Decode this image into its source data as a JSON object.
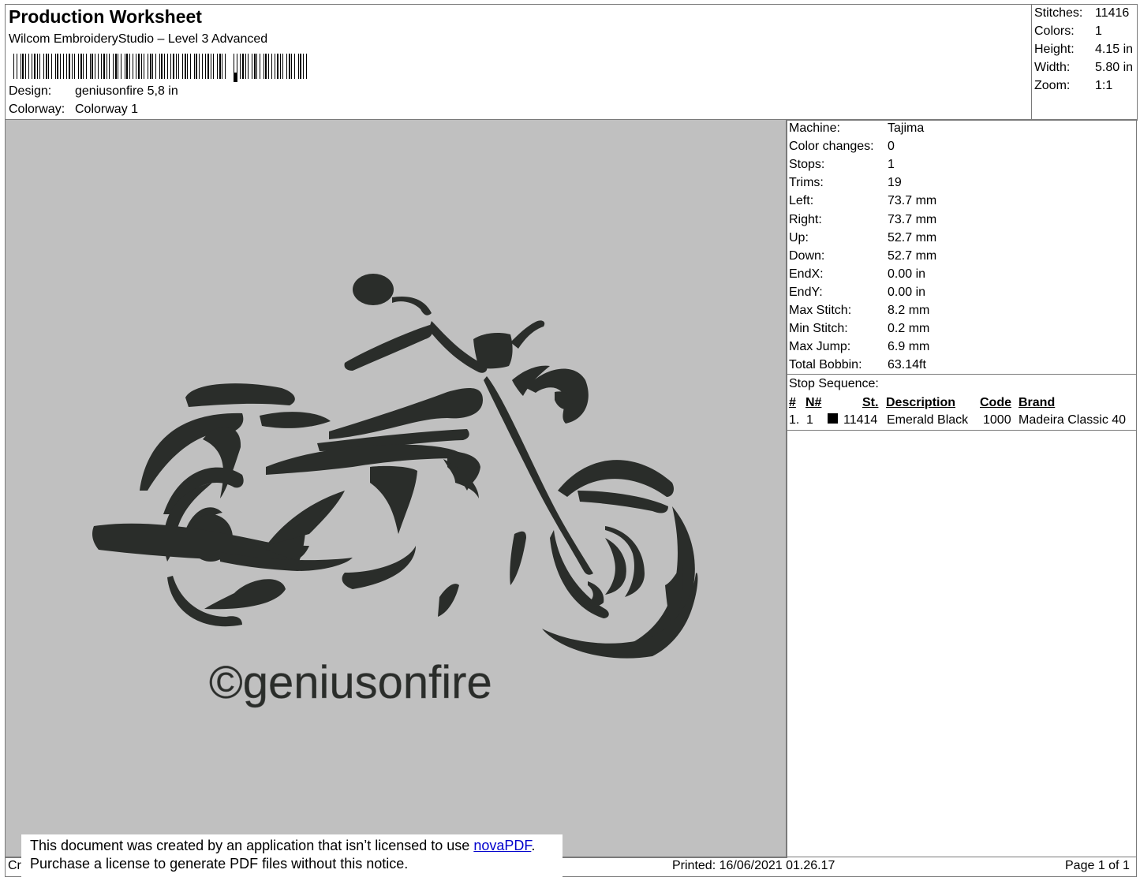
{
  "header": {
    "title": "Production Worksheet",
    "software": "Wilcom EmbroideryStudio – Level 3 Advanced",
    "design_label": "Design:",
    "design_value": "geniusonfire 5,8 in",
    "colorway_label": "Colorway:",
    "colorway_value": "Colorway 1"
  },
  "summary": [
    {
      "label": "Stitches:",
      "value": "11416"
    },
    {
      "label": "Colors:",
      "value": "1"
    },
    {
      "label": "Height:",
      "value": "4.15 in"
    },
    {
      "label": "Width:",
      "value": "5.80 in"
    },
    {
      "label": "Zoom:",
      "value": "1:1"
    }
  ],
  "machine_info": [
    {
      "label": "Machine:",
      "value": "Tajima"
    },
    {
      "label": "Color changes:",
      "value": "0"
    },
    {
      "label": "Stops:",
      "value": "1"
    },
    {
      "label": "Trims:",
      "value": "19"
    },
    {
      "label": "Left:",
      "value": "73.7 mm"
    },
    {
      "label": "Right:",
      "value": "73.7 mm"
    },
    {
      "label": "Up:",
      "value": "52.7 mm"
    },
    {
      "label": "Down:",
      "value": "52.7 mm"
    },
    {
      "label": "EndX:",
      "value": "0.00 in"
    },
    {
      "label": "EndY:",
      "value": "0.00 in"
    },
    {
      "label": "Max Stitch:",
      "value": "8.2 mm"
    },
    {
      "label": "Min Stitch:",
      "value": "0.2 mm"
    },
    {
      "label": "Max Jump:",
      "value": "6.9 mm"
    },
    {
      "label": "Total Bobbin:",
      "value": "63.14ft"
    }
  ],
  "stop_sequence": {
    "title": "Stop Sequence:",
    "headers": {
      "num": "#",
      "n": "N#",
      "st": "St.",
      "description": "Description",
      "code": "Code",
      "brand": "Brand"
    },
    "rows": [
      {
        "num": "1.",
        "n": "1",
        "color": "#000000",
        "st": "11414",
        "description": "Emerald Black",
        "code": "1000",
        "brand": "Madeira Classic 40"
      }
    ]
  },
  "design_text": "©geniusonfire",
  "footer": {
    "left_truncated": "Cr",
    "printed": "Printed: 16/06/2021 01.26.17",
    "page": "Page 1 of 1"
  },
  "notice": {
    "line1_prefix": "This document was created by an application that isn’t licensed to use ",
    "link": "novaPDF",
    "line1_suffix": ".",
    "line2": "Purchase a license to generate PDF files without this notice."
  },
  "colors": {
    "canvas": "#c0c0c0",
    "thread": "#2a2d2a",
    "link": "#0000cc"
  }
}
